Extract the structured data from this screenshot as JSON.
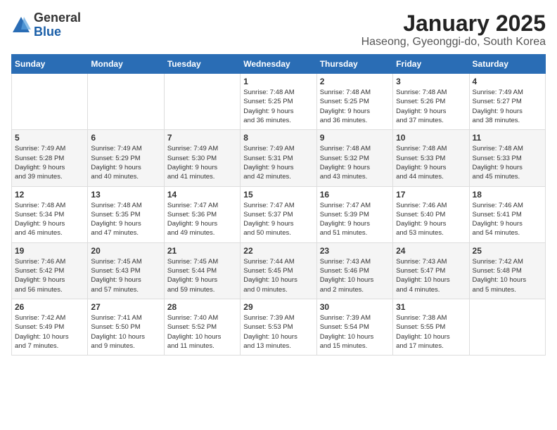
{
  "header": {
    "logo_general": "General",
    "logo_blue": "Blue",
    "title": "January 2025",
    "subtitle": "Haseong, Gyeonggi-do, South Korea"
  },
  "days_of_week": [
    "Sunday",
    "Monday",
    "Tuesday",
    "Wednesday",
    "Thursday",
    "Friday",
    "Saturday"
  ],
  "weeks": [
    [
      {
        "day": "",
        "content": ""
      },
      {
        "day": "",
        "content": ""
      },
      {
        "day": "",
        "content": ""
      },
      {
        "day": "1",
        "content": "Sunrise: 7:48 AM\nSunset: 5:25 PM\nDaylight: 9 hours\nand 36 minutes."
      },
      {
        "day": "2",
        "content": "Sunrise: 7:48 AM\nSunset: 5:25 PM\nDaylight: 9 hours\nand 36 minutes."
      },
      {
        "day": "3",
        "content": "Sunrise: 7:48 AM\nSunset: 5:26 PM\nDaylight: 9 hours\nand 37 minutes."
      },
      {
        "day": "4",
        "content": "Sunrise: 7:49 AM\nSunset: 5:27 PM\nDaylight: 9 hours\nand 38 minutes."
      }
    ],
    [
      {
        "day": "5",
        "content": "Sunrise: 7:49 AM\nSunset: 5:28 PM\nDaylight: 9 hours\nand 39 minutes."
      },
      {
        "day": "6",
        "content": "Sunrise: 7:49 AM\nSunset: 5:29 PM\nDaylight: 9 hours\nand 40 minutes."
      },
      {
        "day": "7",
        "content": "Sunrise: 7:49 AM\nSunset: 5:30 PM\nDaylight: 9 hours\nand 41 minutes."
      },
      {
        "day": "8",
        "content": "Sunrise: 7:49 AM\nSunset: 5:31 PM\nDaylight: 9 hours\nand 42 minutes."
      },
      {
        "day": "9",
        "content": "Sunrise: 7:48 AM\nSunset: 5:32 PM\nDaylight: 9 hours\nand 43 minutes."
      },
      {
        "day": "10",
        "content": "Sunrise: 7:48 AM\nSunset: 5:33 PM\nDaylight: 9 hours\nand 44 minutes."
      },
      {
        "day": "11",
        "content": "Sunrise: 7:48 AM\nSunset: 5:33 PM\nDaylight: 9 hours\nand 45 minutes."
      }
    ],
    [
      {
        "day": "12",
        "content": "Sunrise: 7:48 AM\nSunset: 5:34 PM\nDaylight: 9 hours\nand 46 minutes."
      },
      {
        "day": "13",
        "content": "Sunrise: 7:48 AM\nSunset: 5:35 PM\nDaylight: 9 hours\nand 47 minutes."
      },
      {
        "day": "14",
        "content": "Sunrise: 7:47 AM\nSunset: 5:36 PM\nDaylight: 9 hours\nand 49 minutes."
      },
      {
        "day": "15",
        "content": "Sunrise: 7:47 AM\nSunset: 5:37 PM\nDaylight: 9 hours\nand 50 minutes."
      },
      {
        "day": "16",
        "content": "Sunrise: 7:47 AM\nSunset: 5:39 PM\nDaylight: 9 hours\nand 51 minutes."
      },
      {
        "day": "17",
        "content": "Sunrise: 7:46 AM\nSunset: 5:40 PM\nDaylight: 9 hours\nand 53 minutes."
      },
      {
        "day": "18",
        "content": "Sunrise: 7:46 AM\nSunset: 5:41 PM\nDaylight: 9 hours\nand 54 minutes."
      }
    ],
    [
      {
        "day": "19",
        "content": "Sunrise: 7:46 AM\nSunset: 5:42 PM\nDaylight: 9 hours\nand 56 minutes."
      },
      {
        "day": "20",
        "content": "Sunrise: 7:45 AM\nSunset: 5:43 PM\nDaylight: 9 hours\nand 57 minutes."
      },
      {
        "day": "21",
        "content": "Sunrise: 7:45 AM\nSunset: 5:44 PM\nDaylight: 9 hours\nand 59 minutes."
      },
      {
        "day": "22",
        "content": "Sunrise: 7:44 AM\nSunset: 5:45 PM\nDaylight: 10 hours\nand 0 minutes."
      },
      {
        "day": "23",
        "content": "Sunrise: 7:43 AM\nSunset: 5:46 PM\nDaylight: 10 hours\nand 2 minutes."
      },
      {
        "day": "24",
        "content": "Sunrise: 7:43 AM\nSunset: 5:47 PM\nDaylight: 10 hours\nand 4 minutes."
      },
      {
        "day": "25",
        "content": "Sunrise: 7:42 AM\nSunset: 5:48 PM\nDaylight: 10 hours\nand 5 minutes."
      }
    ],
    [
      {
        "day": "26",
        "content": "Sunrise: 7:42 AM\nSunset: 5:49 PM\nDaylight: 10 hours\nand 7 minutes."
      },
      {
        "day": "27",
        "content": "Sunrise: 7:41 AM\nSunset: 5:50 PM\nDaylight: 10 hours\nand 9 minutes."
      },
      {
        "day": "28",
        "content": "Sunrise: 7:40 AM\nSunset: 5:52 PM\nDaylight: 10 hours\nand 11 minutes."
      },
      {
        "day": "29",
        "content": "Sunrise: 7:39 AM\nSunset: 5:53 PM\nDaylight: 10 hours\nand 13 minutes."
      },
      {
        "day": "30",
        "content": "Sunrise: 7:39 AM\nSunset: 5:54 PM\nDaylight: 10 hours\nand 15 minutes."
      },
      {
        "day": "31",
        "content": "Sunrise: 7:38 AM\nSunset: 5:55 PM\nDaylight: 10 hours\nand 17 minutes."
      },
      {
        "day": "",
        "content": ""
      }
    ]
  ]
}
